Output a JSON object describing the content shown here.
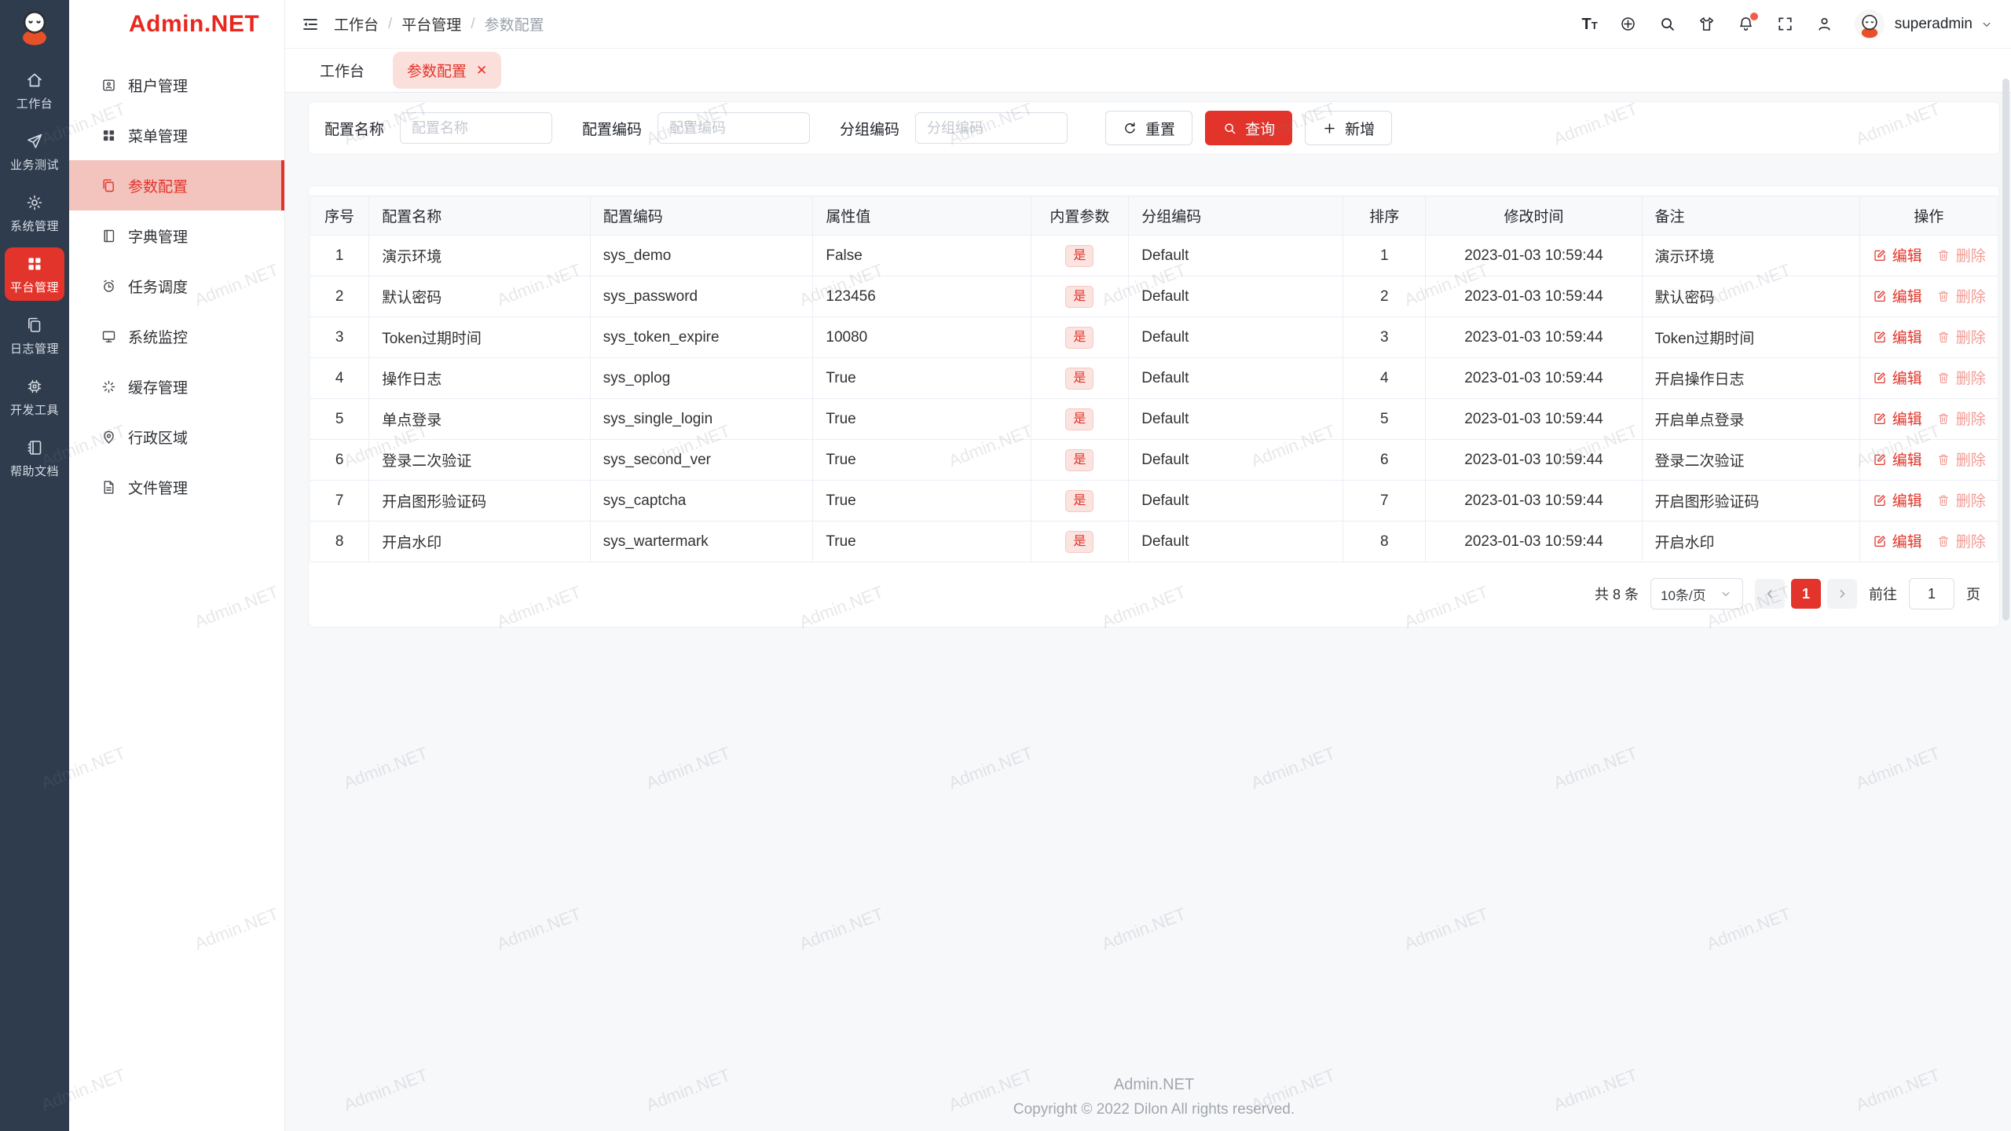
{
  "app": {
    "watermark": "Admin.NET"
  },
  "colors": {
    "primary": "#e2342a",
    "rail_bg": "#2e3c4e",
    "sidebar_active_bg": "#f3c3bd",
    "tab_active_bg": "#fbdfdb",
    "tag_bg": "#fbe3e0",
    "tag_text": "#e2342a",
    "table_header_bg": "#f8f9fb",
    "delete_disabled": "#f29b94"
  },
  "rail": {
    "items": [
      {
        "label": "工作台",
        "icon": "home-icon",
        "active": false
      },
      {
        "label": "业务测试",
        "icon": "send-icon",
        "active": false
      },
      {
        "label": "系统管理",
        "icon": "gear-icon",
        "active": false
      },
      {
        "label": "平台管理",
        "icon": "grid-icon",
        "active": true
      },
      {
        "label": "日志管理",
        "icon": "copy-icon",
        "active": false
      },
      {
        "label": "开发工具",
        "icon": "chip-icon",
        "active": false
      },
      {
        "label": "帮助文档",
        "icon": "book-icon",
        "active": false
      }
    ]
  },
  "sidebar": {
    "logo": "Admin.NET",
    "items": [
      {
        "label": "租户管理",
        "icon": "tenant-icon",
        "active": false
      },
      {
        "label": "菜单管理",
        "icon": "menu-grid-icon",
        "active": false
      },
      {
        "label": "参数配置",
        "icon": "copy-icon",
        "active": true
      },
      {
        "label": "字典管理",
        "icon": "dict-icon",
        "active": false
      },
      {
        "label": "任务调度",
        "icon": "clock-icon",
        "active": false
      },
      {
        "label": "系统监控",
        "icon": "monitor-icon",
        "active": false
      },
      {
        "label": "缓存管理",
        "icon": "cache-icon",
        "active": false
      },
      {
        "label": "行政区域",
        "icon": "pin-icon",
        "active": false
      },
      {
        "label": "文件管理",
        "icon": "file-icon",
        "active": false
      }
    ]
  },
  "header": {
    "breadcrumb": [
      "工作台",
      "平台管理",
      "参数配置"
    ],
    "font_size_glyph": "T",
    "icons": [
      "font-size-icon",
      "language-icon",
      "search-icon",
      "theme-icon",
      "notification-icon",
      "fullscreen-icon",
      "profile-icon"
    ],
    "user": "superadmin"
  },
  "tabs": [
    {
      "label": "工作台",
      "active": false,
      "closable": false
    },
    {
      "label": "参数配置",
      "active": true,
      "closable": true
    }
  ],
  "search": {
    "fields": [
      {
        "label": "配置名称",
        "placeholder": "配置名称",
        "value": ""
      },
      {
        "label": "配置编码",
        "placeholder": "配置编码",
        "value": ""
      },
      {
        "label": "分组编码",
        "placeholder": "分组编码",
        "value": ""
      }
    ],
    "reset_label": "重置",
    "query_label": "查询",
    "add_label": "新增"
  },
  "table": {
    "columns": [
      "序号",
      "配置名称",
      "配置编码",
      "属性值",
      "内置参数",
      "分组编码",
      "排序",
      "修改时间",
      "备注",
      "操作"
    ],
    "builtin_tag": "是",
    "edit_label": "编辑",
    "delete_label": "删除",
    "rows": [
      {
        "index": "1",
        "name": "演示环境",
        "code": "sys_demo",
        "value": "False",
        "builtin": "是",
        "group": "Default",
        "order": "1",
        "time": "2023-01-03 10:59:44",
        "remark": "演示环境"
      },
      {
        "index": "2",
        "name": "默认密码",
        "code": "sys_password",
        "value": "123456",
        "builtin": "是",
        "group": "Default",
        "order": "2",
        "time": "2023-01-03 10:59:44",
        "remark": "默认密码"
      },
      {
        "index": "3",
        "name": "Token过期时间",
        "code": "sys_token_expire",
        "value": "10080",
        "builtin": "是",
        "group": "Default",
        "order": "3",
        "time": "2023-01-03 10:59:44",
        "remark": "Token过期时间"
      },
      {
        "index": "4",
        "name": "操作日志",
        "code": "sys_oplog",
        "value": "True",
        "builtin": "是",
        "group": "Default",
        "order": "4",
        "time": "2023-01-03 10:59:44",
        "remark": "开启操作日志"
      },
      {
        "index": "5",
        "name": "单点登录",
        "code": "sys_single_login",
        "value": "True",
        "builtin": "是",
        "group": "Default",
        "order": "5",
        "time": "2023-01-03 10:59:44",
        "remark": "开启单点登录"
      },
      {
        "index": "6",
        "name": "登录二次验证",
        "code": "sys_second_ver",
        "value": "True",
        "builtin": "是",
        "group": "Default",
        "order": "6",
        "time": "2023-01-03 10:59:44",
        "remark": "登录二次验证"
      },
      {
        "index": "7",
        "name": "开启图形验证码",
        "code": "sys_captcha",
        "value": "True",
        "builtin": "是",
        "group": "Default",
        "order": "7",
        "time": "2023-01-03 10:59:44",
        "remark": "开启图形验证码"
      },
      {
        "index": "8",
        "name": "开启水印",
        "code": "sys_wartermark",
        "value": "True",
        "builtin": "是",
        "group": "Default",
        "order": "8",
        "time": "2023-01-03 10:59:44",
        "remark": "开启水印"
      }
    ]
  },
  "pagination": {
    "total_text": "共 8 条",
    "page_size": "10条/页",
    "current_page": "1",
    "goto_label": "前往",
    "goto_value": "1",
    "page_suffix": "页"
  },
  "footer": {
    "line1": "Admin.NET",
    "line2": "Copyright © 2022 Dilon All rights reserved."
  }
}
